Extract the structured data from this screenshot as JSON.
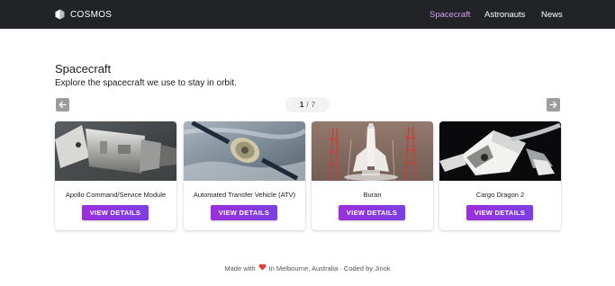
{
  "navbar": {
    "brand": "COSMOS",
    "brand_icon": "hexagon-logo-icon",
    "links": [
      {
        "label": "Spacecraft",
        "active": true
      },
      {
        "label": "Astronauts",
        "active": false
      },
      {
        "label": "News",
        "active": false
      }
    ],
    "background": "#222327",
    "active_color": "#d79cf7"
  },
  "page": {
    "title": "Spacecraft",
    "subtitle": "Explore the spacecraft we use to stay in orbit."
  },
  "pagination": {
    "current": "1",
    "separator": "/",
    "total": "7",
    "prev_icon": "arrow-left-icon",
    "next_icon": "arrow-right-icon"
  },
  "cards": [
    {
      "name": "Apollo Command/Service Module",
      "button": "VIEW DETAILS",
      "image": "apollo-csm-photo"
    },
    {
      "name": "Automated Transfer Vehicle (ATV)",
      "button": "VIEW DETAILS",
      "image": "atv-photo"
    },
    {
      "name": "Buran",
      "button": "VIEW DETAILS",
      "image": "buran-photo"
    },
    {
      "name": "Cargo Dragon 2",
      "button": "VIEW DETAILS",
      "image": "cargo-dragon-photo"
    }
  ],
  "button_gradient": [
    "#9b2fdc",
    "#7b3fe4"
  ],
  "footer": {
    "prefix": "Made with",
    "heart_icon": "heart-icon",
    "suffix": "In Melbourne, Australia · Coded by Jinok",
    "heart_color": "#e53935"
  }
}
